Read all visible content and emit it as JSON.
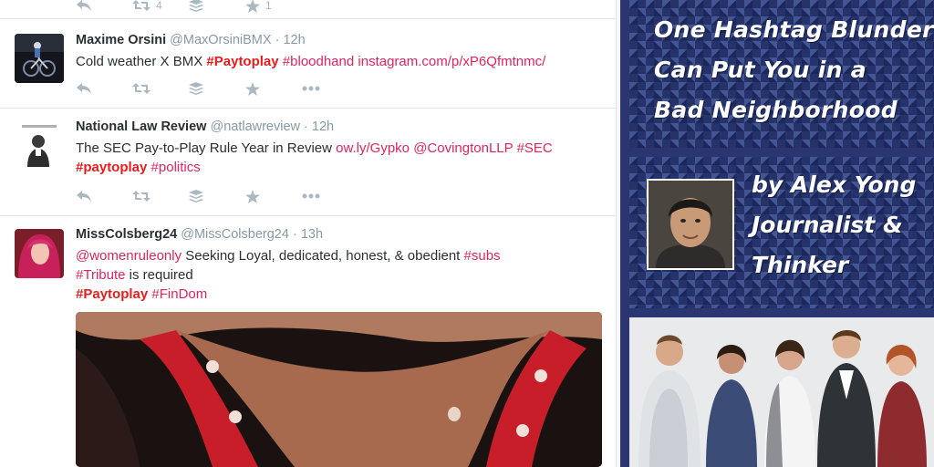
{
  "tweets": [
    {
      "counts": {
        "retweets": "4",
        "favorites": "1"
      }
    },
    {
      "name": "Maxime Orsini",
      "handle": "@MaxOrsiniBMX",
      "time": "· 12h",
      "text_plain": "Cold weather X BMX ",
      "tag_bold": "#Paytoplay",
      "tag2": "#bloodhand",
      "link": "instagram.com/p/xP6Qfmtnmc/"
    },
    {
      "name": "National Law Review",
      "handle": "@natlawreview",
      "time": "· 12h",
      "text_plain": "The SEC Pay-to-Play Rule Year in Review ",
      "link": "ow.ly/Gypko",
      "mention": "@CovingtonLLP",
      "tag_sec": "#SEC",
      "tag_bold": "#paytoplay",
      "tag_pol": "#politics"
    },
    {
      "name": "MissColsberg24",
      "handle": "@MissColsberg24",
      "time": "· 13h",
      "mention": "@womenruleonly",
      "text_plain": " Seeking Loyal, dedicated, honest, & obedient ",
      "tag_subs": "#subs",
      "tag_tribute": "#Tribute",
      "text_plain2": " is required",
      "tag_bold": "#Paytoplay",
      "tag_findom": "#FinDom"
    }
  ],
  "graphic": {
    "title_lines": [
      "One Hashtag Blunder",
      "Can Put You in a",
      "Bad Neighborhood"
    ],
    "author_lines": [
      "by Alex Yong",
      "Journalist &",
      "Thinker"
    ]
  },
  "icons": {
    "reply": "reply-icon",
    "retweet": "retweet-icon",
    "buffer": "buffer-icon",
    "favorite": "star-icon",
    "more": "more-icon"
  },
  "colors": {
    "hashtag": "#e0245e",
    "hashtag_bold": "#e81c1c",
    "panel_bg": "#26336b",
    "action_icon": "#aab8c2"
  }
}
